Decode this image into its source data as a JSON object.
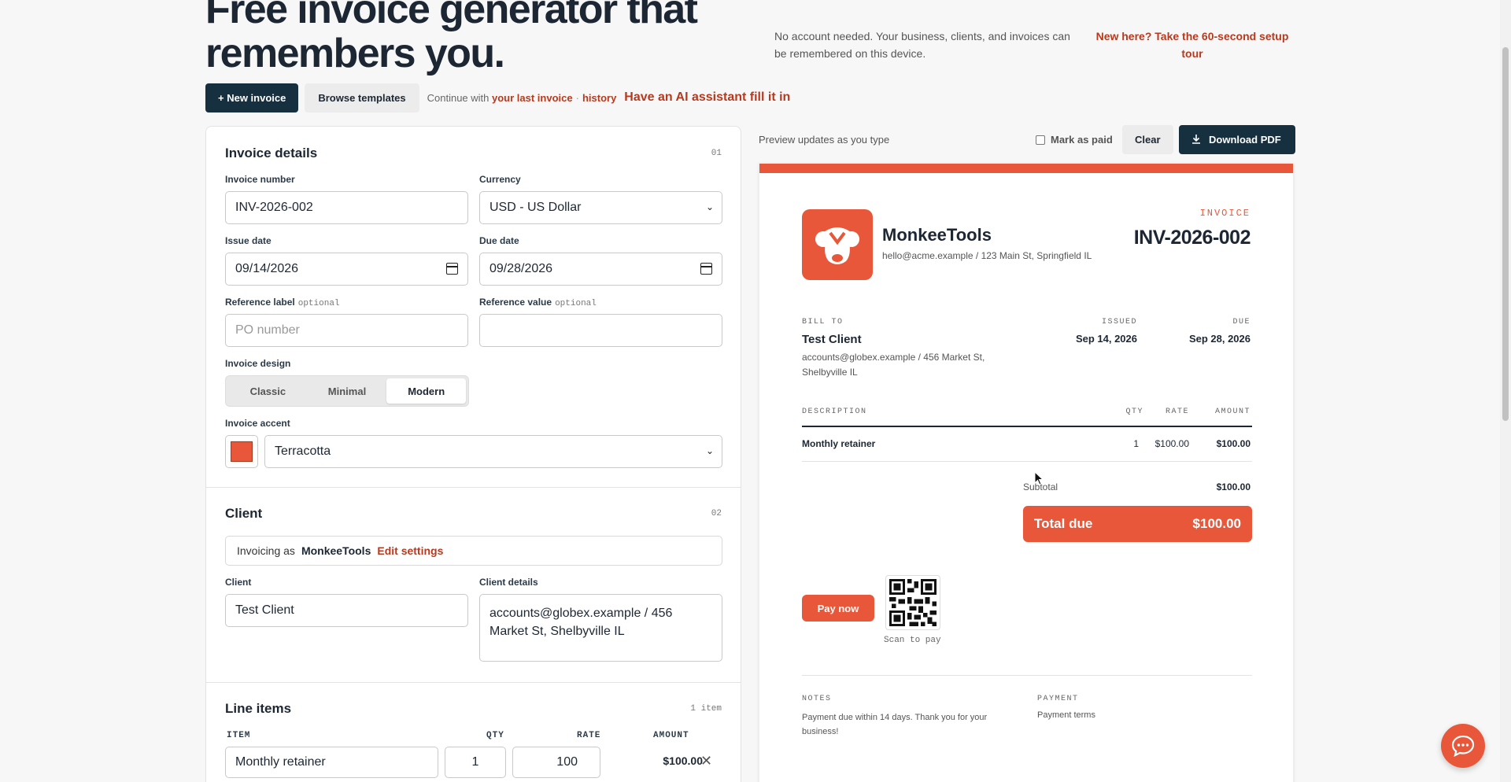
{
  "hero": {
    "title": "Free invoice generator that remembers you.",
    "subtitle": "No account needed. Your business, clients, and invoices can be remembered on this device.",
    "tour_link": "New here? Take the 60-second setup tour"
  },
  "actions": {
    "new_invoice": "+ New invoice",
    "browse_templates": "Browse templates",
    "continue_prefix": "Continue with",
    "last_invoice": "your last invoice",
    "separator": "·",
    "history": "history",
    "ai_assistant": "Have an AI assistant fill it in"
  },
  "invoice_details": {
    "title": "Invoice details",
    "num": "01",
    "invoice_number_label": "Invoice number",
    "invoice_number": "INV-2026-002",
    "currency_label": "Currency",
    "currency": "USD - US Dollar",
    "issue_date_label": "Issue date",
    "issue_date": "09/14/2026",
    "due_date_label": "Due date",
    "due_date": "09/28/2026",
    "ref_label_label": "Reference label",
    "ref_value_label": "Reference value",
    "optional": "optional",
    "ref_label_placeholder": "PO number",
    "ref_value": "",
    "design_label": "Invoice design",
    "designs": [
      "Classic",
      "Minimal",
      "Modern"
    ],
    "design_selected": "Modern",
    "accent_label": "Invoice accent",
    "accent_name": "Terracotta",
    "accent_color": "#e8573a"
  },
  "client": {
    "title": "Client",
    "num": "02",
    "invoicing_as_prefix": "Invoicing as",
    "business": "MonkeeTools",
    "edit_settings": "Edit settings",
    "client_label": "Client",
    "client_name": "Test Client",
    "details_label": "Client details",
    "details": "accounts@globex.example / 456 Market St, Shelbyville IL"
  },
  "line_items": {
    "title": "Line items",
    "count": "1 item",
    "headers": {
      "item": "ITEM",
      "qty": "QTY",
      "rate": "RATE",
      "amount": "AMOUNT"
    },
    "items": [
      {
        "item": "Monthly retainer",
        "qty": "1",
        "rate": "100",
        "amount": "$100.00"
      }
    ]
  },
  "preview": {
    "hint": "Preview updates as you type",
    "mark_paid": "Mark as paid",
    "clear": "Clear",
    "download": "Download PDF",
    "business_name": "MonkeeTools",
    "business_contact": "hello@acme.example / 123 Main St, Springfield IL",
    "invoice_label": "INVOICE",
    "invoice_number": "INV-2026-002",
    "bill_to_label": "BILL TO",
    "bill_to_name": "Test Client",
    "bill_to_details": "accounts@globex.example / 456 Market St, Shelbyville IL",
    "issued_label": "ISSUED",
    "issued": "Sep 14, 2026",
    "due_label": "DUE",
    "due": "Sep 28, 2026",
    "table_headers": {
      "description": "DESCRIPTION",
      "qty": "QTY",
      "rate": "RATE",
      "amount": "AMOUNT"
    },
    "rows": [
      {
        "description": "Monthly retainer",
        "qty": "1",
        "rate": "$100.00",
        "amount": "$100.00"
      }
    ],
    "subtotal_label": "Subtotal",
    "subtotal": "$100.00",
    "total_label": "Total due",
    "total": "$100.00",
    "pay_now": "Pay now",
    "scan_to_pay": "Scan to pay",
    "notes_label": "NOTES",
    "notes": "Payment due within 14 days. Thank you for your business!",
    "payment_label": "PAYMENT",
    "payment": "Payment terms"
  },
  "colors": {
    "accent": "#e8573a",
    "navy": "#16303f",
    "link": "#b8391d"
  },
  "icons": {
    "chat": "chat-bubble-icon",
    "download": "download-icon",
    "remove": "close-icon",
    "calendar": "calendar-icon",
    "logo": "monkey-logo-icon"
  }
}
